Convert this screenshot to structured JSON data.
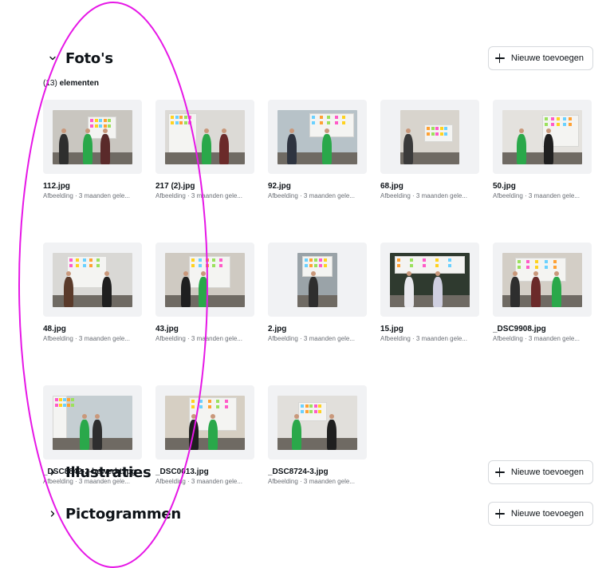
{
  "sections": {
    "photos": {
      "title": "Foto's",
      "count_prefix": "(13)",
      "count_label": "elementen",
      "add_label": "Nieuwe toevoegen"
    },
    "illustrations": {
      "title": "Illustraties",
      "add_label": "Nieuwe toevoegen"
    },
    "icons": {
      "title": "Pictogrammen",
      "add_label": "Nieuwe toevoegen"
    }
  },
  "items": [
    {
      "name": "112.jpg",
      "meta": "Afbeelding · 3 maanden gele..."
    },
    {
      "name": "217 (2).jpg",
      "meta": "Afbeelding · 3 maanden gele..."
    },
    {
      "name": "92.jpg",
      "meta": "Afbeelding · 3 maanden gele..."
    },
    {
      "name": "68.jpg",
      "meta": "Afbeelding · 3 maanden gele..."
    },
    {
      "name": "50.jpg",
      "meta": "Afbeelding · 3 maanden gele..."
    },
    {
      "name": "48.jpg",
      "meta": "Afbeelding · 3 maanden gele..."
    },
    {
      "name": "43.jpg",
      "meta": "Afbeelding · 3 maanden gele..."
    },
    {
      "name": "2.jpg",
      "meta": "Afbeelding · 3 maanden gele..."
    },
    {
      "name": "15.jpg",
      "meta": "Afbeelding · 3 maanden gele..."
    },
    {
      "name": "_DSC9908.jpg",
      "meta": "Afbeelding · 3 maanden gele..."
    },
    {
      "name": "_DSC8842-2-bewerkt.jpg",
      "meta": "Afbeelding · 3 maanden gele..."
    },
    {
      "name": "_DSC0013.jpg",
      "meta": "Afbeelding · 3 maanden gele..."
    },
    {
      "name": "_DSC8724-3.jpg",
      "meta": "Afbeelding · 3 maanden gele..."
    }
  ],
  "icons": {
    "collapse": "chevron-down-icon",
    "expand": "chevron-right-icon",
    "add": "plus-icon"
  },
  "colors": {
    "annotation": "#e617e6",
    "accent_green": "#2aa84a",
    "text": "#0e1318",
    "muted": "#6b6f76",
    "thumb_bg": "#f1f2f4"
  }
}
